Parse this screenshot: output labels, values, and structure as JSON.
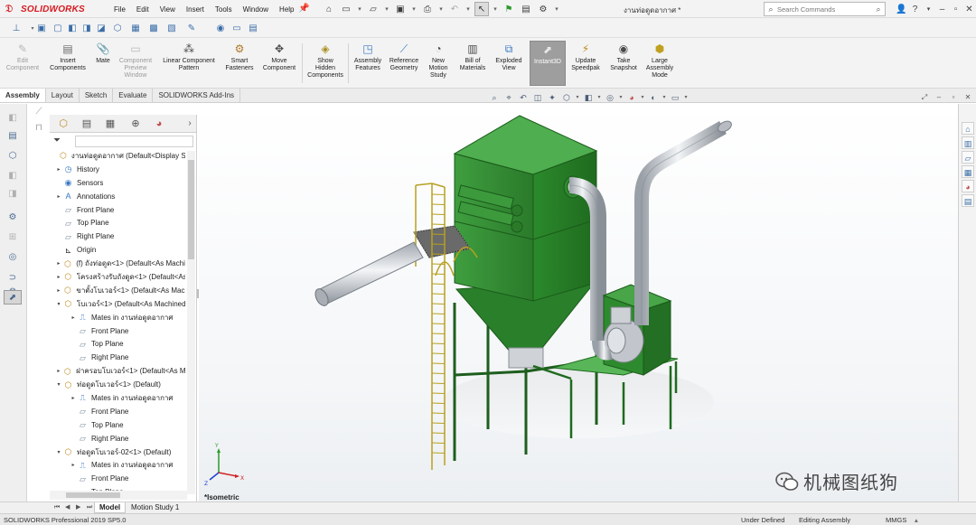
{
  "app": {
    "brand": "SOLIDWORKS",
    "doc_title": "งานท่อดูดอากาศ *",
    "menu": [
      "File",
      "Edit",
      "View",
      "Insert",
      "Tools",
      "Window",
      "Help"
    ],
    "search_placeholder": "Search Commands"
  },
  "commands": [
    {
      "label": "Edit\nComponent",
      "enabled": false
    },
    {
      "label": "Insert\nComponents",
      "enabled": true
    },
    {
      "label": "Mate",
      "enabled": true
    },
    {
      "label": "Component\nPreview\nWindow",
      "enabled": false
    },
    {
      "label": "Linear Component\nPattern",
      "enabled": true
    },
    {
      "label": "Smart\nFasteners",
      "enabled": true
    },
    {
      "label": "Move\nComponent",
      "enabled": true
    },
    {
      "label": "Show\nHidden\nComponents",
      "enabled": true
    },
    {
      "label": "Assembly\nFeatures",
      "enabled": true
    },
    {
      "label": "Reference\nGeometry",
      "enabled": true
    },
    {
      "label": "New\nMotion\nStudy",
      "enabled": true
    },
    {
      "label": "Bill of\nMaterials",
      "enabled": true
    },
    {
      "label": "Exploded\nView",
      "enabled": true
    },
    {
      "label": "Instant3D",
      "enabled": true,
      "active": true
    },
    {
      "label": "Update\nSpeedpak",
      "enabled": true
    },
    {
      "label": "Take\nSnapshot",
      "enabled": true
    },
    {
      "label": "Large\nAssembly\nMode",
      "enabled": true
    }
  ],
  "tabs": [
    "Assembly",
    "Layout",
    "Sketch",
    "Evaluate",
    "SOLIDWORKS Add-Ins"
  ],
  "tree": [
    {
      "label": "งานท่อดูดอากาศ  (Default<Display State",
      "level": 0,
      "icon": "assembly"
    },
    {
      "label": "History",
      "level": 1,
      "icon": "history",
      "exp": "▸"
    },
    {
      "label": "Sensors",
      "level": 1,
      "icon": "sensor"
    },
    {
      "label": "Annotations",
      "level": 1,
      "icon": "annotation",
      "exp": "▸"
    },
    {
      "label": "Front Plane",
      "level": 1,
      "icon": "plane"
    },
    {
      "label": "Top Plane",
      "level": 1,
      "icon": "plane"
    },
    {
      "label": "Right Plane",
      "level": 1,
      "icon": "plane"
    },
    {
      "label": "Origin",
      "level": 1,
      "icon": "origin"
    },
    {
      "label": "(f) ถังท่อดูด<1> (Default<As Machin",
      "level": 1,
      "icon": "subassembly",
      "exp": "▸"
    },
    {
      "label": "โครงสร้างรับถังดูด<1> (Default<As",
      "level": 1,
      "icon": "subassembly",
      "exp": "▸"
    },
    {
      "label": "ขาตั้งโบเวอร์<1> (Default<As Mach",
      "level": 1,
      "icon": "subassembly",
      "exp": "▸"
    },
    {
      "label": "โบเวอร์<1> (Default<As Machined",
      "level": 1,
      "icon": "subassembly",
      "exp": "▾"
    },
    {
      "label": "Mates in งานท่อดูดอากาศ",
      "level": 2,
      "icon": "mates",
      "exp": "▸"
    },
    {
      "label": "Front Plane",
      "level": 2,
      "icon": "plane"
    },
    {
      "label": "Top Plane",
      "level": 2,
      "icon": "plane"
    },
    {
      "label": "Right Plane",
      "level": 2,
      "icon": "plane"
    },
    {
      "label": "ฝาครอบโบเวอร์<1> (Default<As Ma",
      "level": 1,
      "icon": "subassembly",
      "exp": "▸"
    },
    {
      "label": "ท่อดูดโบเวอร์<1> (Default)",
      "level": 1,
      "icon": "subassembly",
      "exp": "▾"
    },
    {
      "label": "Mates in งานท่อดูดอากาศ",
      "level": 2,
      "icon": "mates",
      "exp": "▸"
    },
    {
      "label": "Front Plane",
      "level": 2,
      "icon": "plane"
    },
    {
      "label": "Top Plane",
      "level": 2,
      "icon": "plane"
    },
    {
      "label": "Right Plane",
      "level": 2,
      "icon": "plane"
    },
    {
      "label": "ท่อดูดโบเวอร์-02<1> (Default)",
      "level": 1,
      "icon": "subassembly",
      "exp": "▾"
    },
    {
      "label": "Mates in งานท่อดูดอากาศ",
      "level": 2,
      "icon": "mates",
      "exp": "▸"
    },
    {
      "label": "Front Plane",
      "level": 2,
      "icon": "plane"
    },
    {
      "label": "Top Plane",
      "level": 2,
      "icon": "plane"
    }
  ],
  "view": {
    "orientation": "*Isometric"
  },
  "bottom_tabs": [
    "Model",
    "Motion Study 1"
  ],
  "status": {
    "product": "SOLIDWORKS Professional 2019 SP5.0",
    "definition": "Under Defined",
    "mode": "Editing Assembly",
    "units": "MMGS"
  },
  "watermark": "机械图纸狗",
  "colors": {
    "brand_red": "#d71920",
    "machine_green": "#2e8b2e",
    "duct_silver": "#c8ccd2"
  }
}
